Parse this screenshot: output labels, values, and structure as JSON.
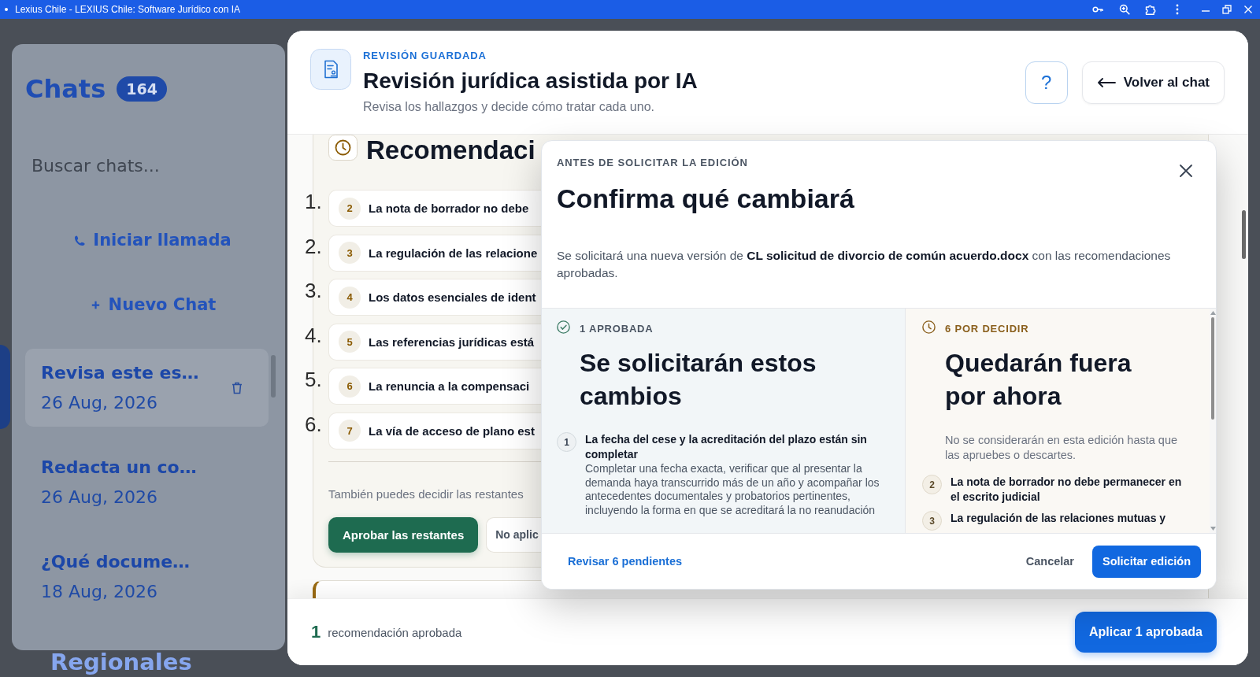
{
  "browser": {
    "title": "Lexius Chile - LEXIUS Chile: Software Jurídico con IA"
  },
  "sidebar": {
    "title": "Chats",
    "count": "164",
    "search": {
      "placeholder": "Buscar chats..."
    },
    "actions": [
      {
        "kind": "call",
        "label": "Iniciar llamada"
      },
      {
        "kind": "new",
        "label": "Nuevo Chat"
      }
    ],
    "chats": [
      {
        "title": "Revisa este es…",
        "date": "26 Aug, 2026",
        "selected": true
      },
      {
        "title": "Redacta un co…",
        "date": "26 Aug, 2026",
        "selected": false
      },
      {
        "title": "¿Qué docume…",
        "date": "18 Aug, 2026",
        "selected": false
      }
    ],
    "section": "Regionales"
  },
  "review": {
    "eyebrow": "REVISIÓN GUARDADA",
    "title": "Revisión jurídica asistida por IA",
    "subtitle": "Revisa los hallazgos y decide cómo tratar cada uno.",
    "help_button": "?",
    "back_button": "Volver al chat"
  },
  "recommendations": {
    "title": "Recomendaci",
    "items": [
      {
        "marker": "1.",
        "number": "2",
        "text": "La nota de borrador no debe"
      },
      {
        "marker": "2.",
        "number": "3",
        "text": "La regulación de las relacione"
      },
      {
        "marker": "3.",
        "number": "4",
        "text": "Los datos esenciales de ident"
      },
      {
        "marker": "4.",
        "number": "5",
        "text": "Las referencias jurídicas está"
      },
      {
        "marker": "5.",
        "number": "6",
        "text": "La renuncia a la compensaci"
      },
      {
        "marker": "6.",
        "number": "7",
        "text": "La vía de acceso de plano est"
      }
    ],
    "hint": "También puedes decidir las restantes",
    "buttons": [
      {
        "kind": "primary",
        "label": "Aprobar las restantes"
      },
      {
        "kind": "secondary",
        "label": "No aplic"
      }
    ]
  },
  "footer": {
    "count": "1",
    "label": "recomendación aprobada",
    "button": "Aplicar 1 aprobada"
  },
  "dialog": {
    "eyebrow": "ANTES DE SOLICITAR LA EDICIÓN",
    "title": "Confirma qué cambiará",
    "message": "Se solicitará una nueva versión de **CL solicitud de divorcio de común acuerdo.docx** con las recomendaciones aprobadas.",
    "columns": [
      {
        "kind": "approved",
        "count_label": "1 APROBADA",
        "title": "Se solicitarán estos cambios",
        "items": [
          {
            "number": "1",
            "title": "La fecha del cese y la acreditación del plazo están sin completar",
            "description": "Completar una fecha exacta, verificar que al presentar la demanda haya transcurrido más de un año y acompañar los antecedentes documentales y probatorios pertinentes, incluyendo la forma en que se acreditará la no reanudación"
          }
        ]
      },
      {
        "kind": "pending",
        "count_label": "6 POR DECIDIR",
        "title": "Quedarán fuera por ahora",
        "note": "No se considerarán en esta edición hasta que las apruebes o descartes.",
        "items": [
          {
            "number": "2",
            "title": "La nota de borrador no debe permanecer en el escrito judicial"
          },
          {
            "number": "3",
            "title": "La regulación de las relaciones mutuas y"
          }
        ]
      }
    ],
    "review_link": "Revisar 6 pendientes",
    "cancel": "Cancelar",
    "submit": "Solicitar edición"
  }
}
